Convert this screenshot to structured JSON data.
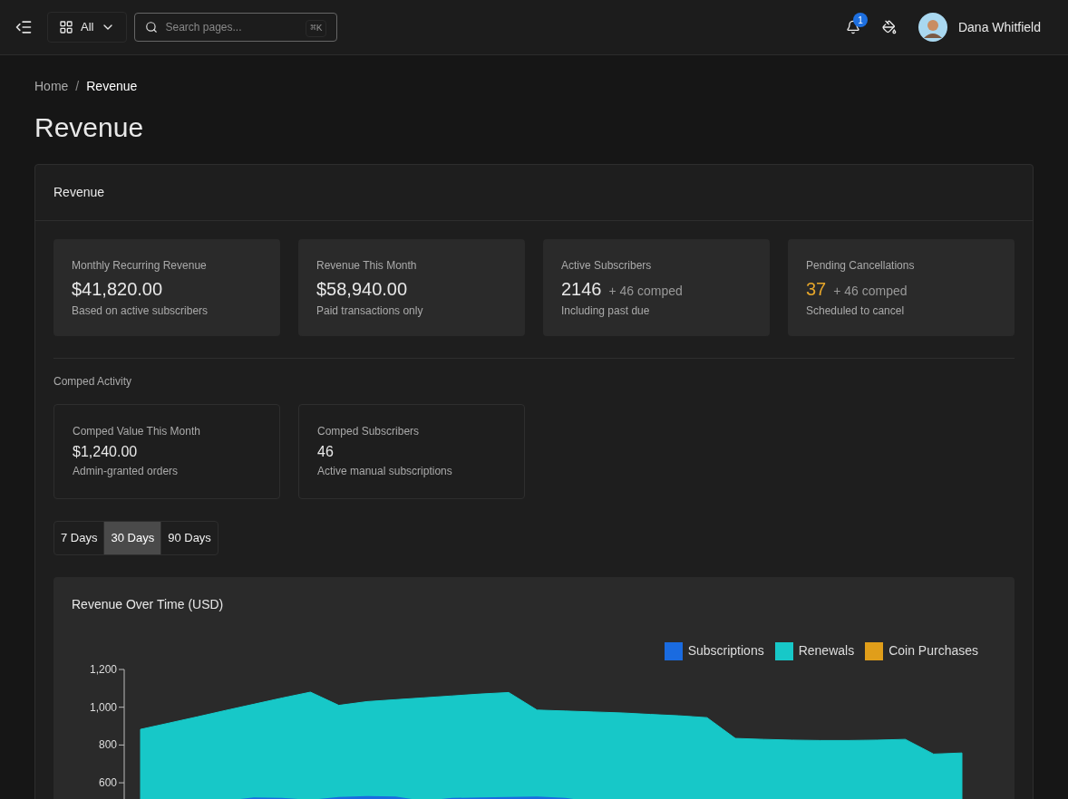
{
  "topbar": {
    "filter": "All",
    "search": {
      "placeholder": "Search pages...",
      "shortcut": "⌘K"
    },
    "notifications": "1",
    "user": "Dana Whitfield"
  },
  "breadcrumb": [
    "Home",
    "Revenue"
  ],
  "breadcrumb_separator": "/",
  "page_title": "Revenue",
  "panel": {
    "title": "Revenue",
    "stats": [
      {
        "label": "Monthly Recurring Revenue",
        "value": "$41,820.00",
        "note": "Based on active subscribers"
      },
      {
        "label": "Revenue This Month",
        "value": "$58,940.00",
        "note": "Paid transactions only"
      },
      {
        "label": "Active Subscribers",
        "value": "2146",
        "extra": "+ 46 comped",
        "note": "Including past due"
      },
      {
        "label": "Pending Cancellations",
        "value": "37",
        "extra": "+ 46 comped",
        "note": "Scheduled to cancel",
        "color": "#e5a52a"
      }
    ],
    "comped_heading": "Comped Activity",
    "comped": [
      {
        "label": "Comped Value This Month",
        "value": "$1,240.00",
        "note": "Admin-granted orders"
      },
      {
        "label": "Comped Subscribers",
        "value": "46",
        "note": "Active manual subscriptions"
      }
    ],
    "ranges": [
      {
        "label": "7 Days",
        "selected": false
      },
      {
        "label": "30 Days",
        "selected": true
      },
      {
        "label": "90 Days",
        "selected": false
      }
    ],
    "chart": {
      "title": "Revenue Over Time (USD)",
      "y_tick_labels": [
        "1,200",
        "1,000",
        "800",
        "600"
      ],
      "legend": [
        {
          "name": "Subscriptions",
          "color": "#1a6be0"
        },
        {
          "name": "Renewals",
          "color": "#17c8c8"
        },
        {
          "name": "Coin Purchases",
          "color": "#e09e1a"
        }
      ]
    }
  }
}
